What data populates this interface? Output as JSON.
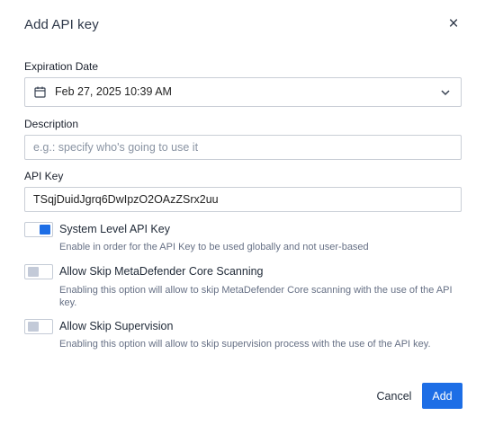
{
  "dialog": {
    "title": "Add API key",
    "close_icon": "close-icon"
  },
  "expiration": {
    "label": "Expiration Date",
    "value": "Feb 27, 2025 10:39 AM",
    "icon": "calendar-icon"
  },
  "description": {
    "label": "Description",
    "placeholder": "e.g.: specify who's going to use it",
    "value": ""
  },
  "api_key": {
    "label": "API Key",
    "value": "TSqjDuidJgrq6DwIpzO2OAzZSrx2uu"
  },
  "options": [
    {
      "label": "System Level API Key",
      "description": "Enable in order for the API Key to be used globally and not user-based",
      "enabled": true
    },
    {
      "label": "Allow Skip MetaDefender Core Scanning",
      "description": "Enabling this option will allow to skip MetaDefender Core scanning with the use of the API key.",
      "enabled": false
    },
    {
      "label": "Allow Skip Supervision",
      "description": "Enabling this option will allow to skip supervision process with the use of the API key.",
      "enabled": false
    }
  ],
  "actions": {
    "cancel_label": "Cancel",
    "add_label": "Add"
  },
  "colors": {
    "accent": "#1d6ee6",
    "toggle_off": "#c3cad8"
  }
}
